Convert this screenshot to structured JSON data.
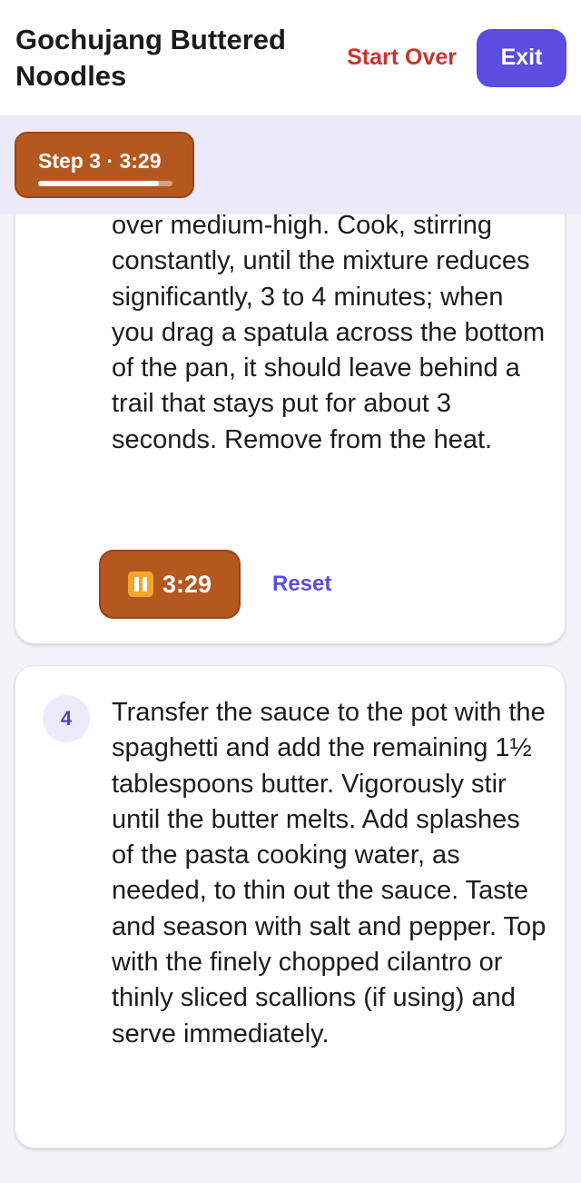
{
  "header": {
    "title": "Gochujang Buttered Noodles",
    "start_over_label": "Start Over",
    "exit_label": "Exit"
  },
  "status": {
    "step_label": "Step 3 · 3:29",
    "progress_fraction": 0.9
  },
  "steps": [
    {
      "number": "3",
      "text": "over medium-high. Cook, stirring constantly, until the mixture reduces significantly, 3 to 4 minutes; when you drag a spatula across the bottom of the pan, it should leave behind a trail that stays put for about 3 seconds. Remove from the heat.",
      "timer": {
        "value": "3:29",
        "icon": "pause-icon",
        "reset_label": "Reset"
      }
    },
    {
      "number": "4",
      "text": "Transfer the sauce to the pot with the spaghetti and add the remaining 1½ tablespoons butter. Vigorously stir until the butter melts. Add splashes of the pasta cooking water, as needed, to thin out the sauce. Taste and season with salt and pepper. Top with the finely chopped cilantro or thinly sliced scallions (if using) and serve immediately."
    }
  ],
  "colors": {
    "accent": "#5b4de0",
    "timer": "#b5581f",
    "start_over": "#c8352e",
    "pause_icon": "#f3a62a"
  }
}
